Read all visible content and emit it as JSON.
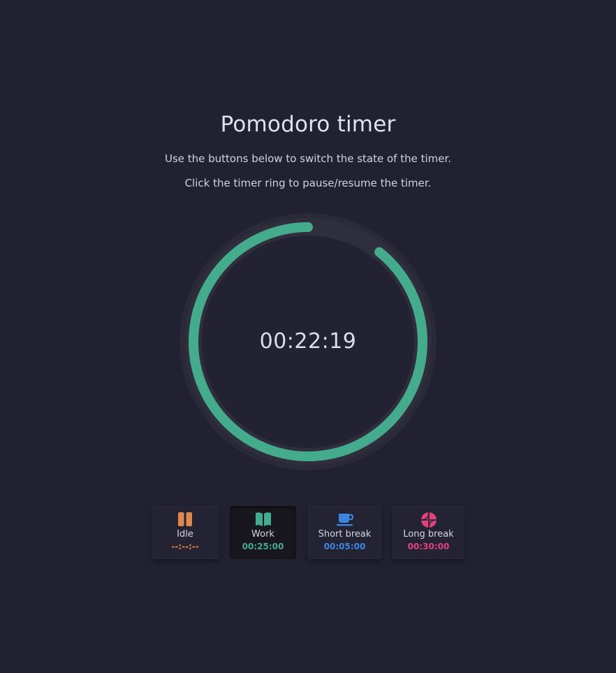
{
  "header": {
    "title": "Pomodoro timer",
    "instruction_1": "Use the buttons below to switch the state of the timer.",
    "instruction_2": "Click the timer ring to pause/resume the timer."
  },
  "timer": {
    "time": "00:22:19",
    "progress_fraction": 0.893,
    "color": "#45ab8d",
    "track_color": "#2f2e3d"
  },
  "modes": [
    {
      "label": "Idle",
      "duration": "--:--:--",
      "icon": "pause-icon",
      "color": "#e0864f",
      "active": false
    },
    {
      "label": "Work",
      "duration": "00:25:00",
      "icon": "book-open-icon",
      "color": "#45ab8d",
      "active": true
    },
    {
      "label": "Short break",
      "duration": "00:05:00",
      "icon": "coffee-cup-icon",
      "color": "#3d86e0",
      "active": false
    },
    {
      "label": "Long break",
      "duration": "00:30:00",
      "icon": "basketball-icon",
      "color": "#e0427c",
      "active": false
    }
  ]
}
